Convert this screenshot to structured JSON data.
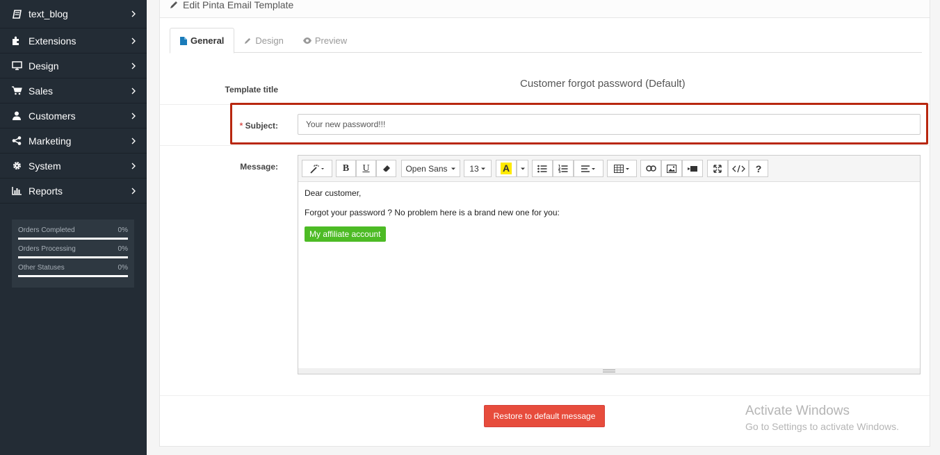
{
  "sidebar": {
    "items": [
      {
        "label": "text_blog",
        "icon": "book-icon"
      },
      {
        "label": "Extensions",
        "icon": "puzzle-icon"
      },
      {
        "label": "Design",
        "icon": "monitor-icon"
      },
      {
        "label": "Sales",
        "icon": "cart-icon"
      },
      {
        "label": "Customers",
        "icon": "user-icon"
      },
      {
        "label": "Marketing",
        "icon": "share-icon"
      },
      {
        "label": "System",
        "icon": "gear-icon"
      },
      {
        "label": "Reports",
        "icon": "bar-chart-icon"
      }
    ],
    "stats": [
      {
        "label": "Orders Completed",
        "value": "0%"
      },
      {
        "label": "Orders Processing",
        "value": "0%"
      },
      {
        "label": "Other Statuses",
        "value": "0%"
      }
    ]
  },
  "panel": {
    "title": "Edit Pinta Email Template"
  },
  "tabs": [
    {
      "label": "General",
      "icon": "file-icon"
    },
    {
      "label": "Design",
      "icon": "pencil-icon"
    },
    {
      "label": "Preview",
      "icon": "eye-icon"
    }
  ],
  "form": {
    "template_title_label": "Template title",
    "template_title_value": "Customer forgot password (Default)",
    "subject_required": "*",
    "subject_label": "Subject:",
    "subject_value": "Your new password!!!",
    "message_label": "Message:"
  },
  "editor": {
    "font_family": "Open Sans",
    "font_size": "13",
    "color_letter": "A",
    "content": {
      "line1": "Dear customer,",
      "line2": "Forgot your password ? No problem here is a brand new one for you:",
      "button": "My affiliate account"
    }
  },
  "footer": {
    "restore_label": "Restore to default message"
  },
  "windows": {
    "title": "Activate Windows",
    "subtitle": "Go to Settings to activate Windows."
  },
  "colors": {
    "sidebar_bg": "#232c35",
    "highlight": "#b8270f",
    "restore_btn": "#e74c3c",
    "affiliate_btn": "#4dbb25"
  }
}
